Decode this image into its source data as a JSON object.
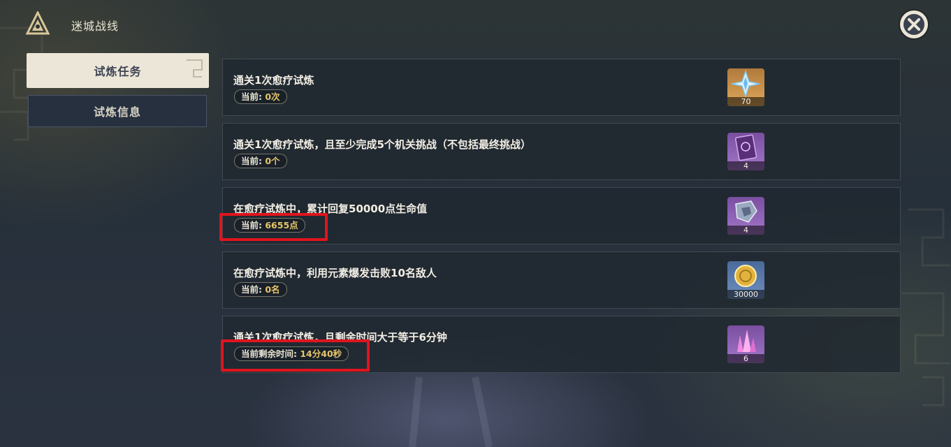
{
  "header": {
    "title": "迷城战线"
  },
  "sidebar": {
    "tabs": [
      {
        "label": "试炼任务",
        "active": true
      },
      {
        "label": "试炼信息",
        "active": false
      }
    ]
  },
  "tasks": [
    {
      "title": "通关1次愈疗试炼",
      "progress_label": "当前:",
      "progress_value": "0次",
      "reward_icon": "primogem-icon",
      "reward_qty": "70"
    },
    {
      "title": "通关1次愈疗试炼，且至少完成5个机关挑战（不包括最终挑战）",
      "progress_label": "当前:",
      "progress_value": "0个",
      "reward_icon": "talent-book-icon",
      "reward_qty": "4"
    },
    {
      "title": "在愈疗试炼中，累计回复50000点生命值",
      "progress_label": "当前:",
      "progress_value": "6655点",
      "reward_icon": "weapon-material-icon",
      "reward_qty": "4"
    },
    {
      "title": "在愈疗试炼中，利用元素爆发击败10名敌人",
      "progress_label": "当前:",
      "progress_value": "0名",
      "reward_icon": "mora-coin-icon",
      "reward_qty": "30000"
    },
    {
      "title": "通关1次愈疗试炼，且剩余时间大于等于6分钟",
      "progress_label": "当前剩余时间:",
      "progress_value": "14分40秒",
      "reward_icon": "crystal-icon",
      "reward_qty": "6"
    }
  ],
  "colors": {
    "highlight": "#e0141e",
    "progress_value": "#e6c56a",
    "active_tab": "#ece6d9"
  }
}
